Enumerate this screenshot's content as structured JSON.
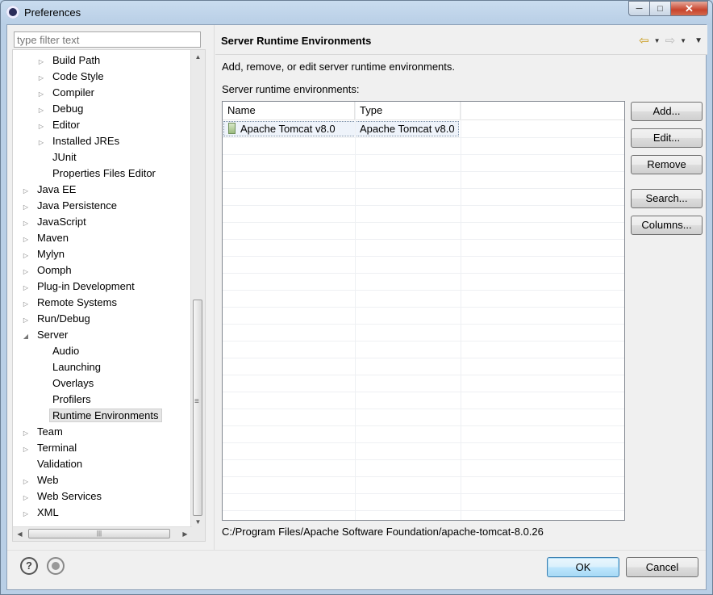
{
  "window": {
    "title": "Preferences"
  },
  "filter": {
    "placeholder": "type filter text"
  },
  "tree": {
    "items": [
      {
        "label": "Build Path",
        "level": 1,
        "twisty": "collapsed"
      },
      {
        "label": "Code Style",
        "level": 1,
        "twisty": "collapsed"
      },
      {
        "label": "Compiler",
        "level": 1,
        "twisty": "collapsed"
      },
      {
        "label": "Debug",
        "level": 1,
        "twisty": "collapsed"
      },
      {
        "label": "Editor",
        "level": 1,
        "twisty": "collapsed"
      },
      {
        "label": "Installed JREs",
        "level": 1,
        "twisty": "collapsed"
      },
      {
        "label": "JUnit",
        "level": 1,
        "twisty": "none"
      },
      {
        "label": "Properties Files Editor",
        "level": 1,
        "twisty": "none"
      },
      {
        "label": "Java EE",
        "level": 0,
        "twisty": "collapsed"
      },
      {
        "label": "Java Persistence",
        "level": 0,
        "twisty": "collapsed"
      },
      {
        "label": "JavaScript",
        "level": 0,
        "twisty": "collapsed"
      },
      {
        "label": "Maven",
        "level": 0,
        "twisty": "collapsed"
      },
      {
        "label": "Mylyn",
        "level": 0,
        "twisty": "collapsed"
      },
      {
        "label": "Oomph",
        "level": 0,
        "twisty": "collapsed"
      },
      {
        "label": "Plug-in Development",
        "level": 0,
        "twisty": "collapsed"
      },
      {
        "label": "Remote Systems",
        "level": 0,
        "twisty": "collapsed"
      },
      {
        "label": "Run/Debug",
        "level": 0,
        "twisty": "collapsed"
      },
      {
        "label": "Server",
        "level": 0,
        "twisty": "expanded"
      },
      {
        "label": "Audio",
        "level": 1,
        "twisty": "none"
      },
      {
        "label": "Launching",
        "level": 1,
        "twisty": "none"
      },
      {
        "label": "Overlays",
        "level": 1,
        "twisty": "none"
      },
      {
        "label": "Profilers",
        "level": 1,
        "twisty": "none"
      },
      {
        "label": "Runtime Environments",
        "level": 1,
        "twisty": "none",
        "selected": true
      },
      {
        "label": "Team",
        "level": 0,
        "twisty": "collapsed"
      },
      {
        "label": "Terminal",
        "level": 0,
        "twisty": "collapsed"
      },
      {
        "label": "Validation",
        "level": 0,
        "twisty": "none"
      },
      {
        "label": "Web",
        "level": 0,
        "twisty": "collapsed"
      },
      {
        "label": "Web Services",
        "level": 0,
        "twisty": "collapsed"
      },
      {
        "label": "XML",
        "level": 0,
        "twisty": "collapsed"
      }
    ]
  },
  "page": {
    "title": "Server Runtime Environments",
    "description": "Add, remove, or edit server runtime environments.",
    "list_label": "Server runtime environments:",
    "columns": [
      "Name",
      "Type"
    ],
    "rows": [
      {
        "name": "Apache Tomcat v8.0",
        "type": "Apache Tomcat v8.0",
        "checked": true
      }
    ],
    "path": "C:/Program Files/Apache Software Foundation/apache-tomcat-8.0.26"
  },
  "buttons": {
    "add": "Add...",
    "edit": "Edit...",
    "remove": "Remove",
    "search": "Search...",
    "columns": "Columns..."
  },
  "dialog": {
    "ok": "OK",
    "cancel": "Cancel"
  },
  "icons": {
    "back": "back-arrow-icon",
    "forward": "forward-arrow-icon",
    "help": "help-icon",
    "record": "record-macro-icon"
  },
  "colors": {
    "titlebar": "#b9cfe6",
    "close_button": "#c8442d",
    "ok_button": "#bee6fd"
  }
}
